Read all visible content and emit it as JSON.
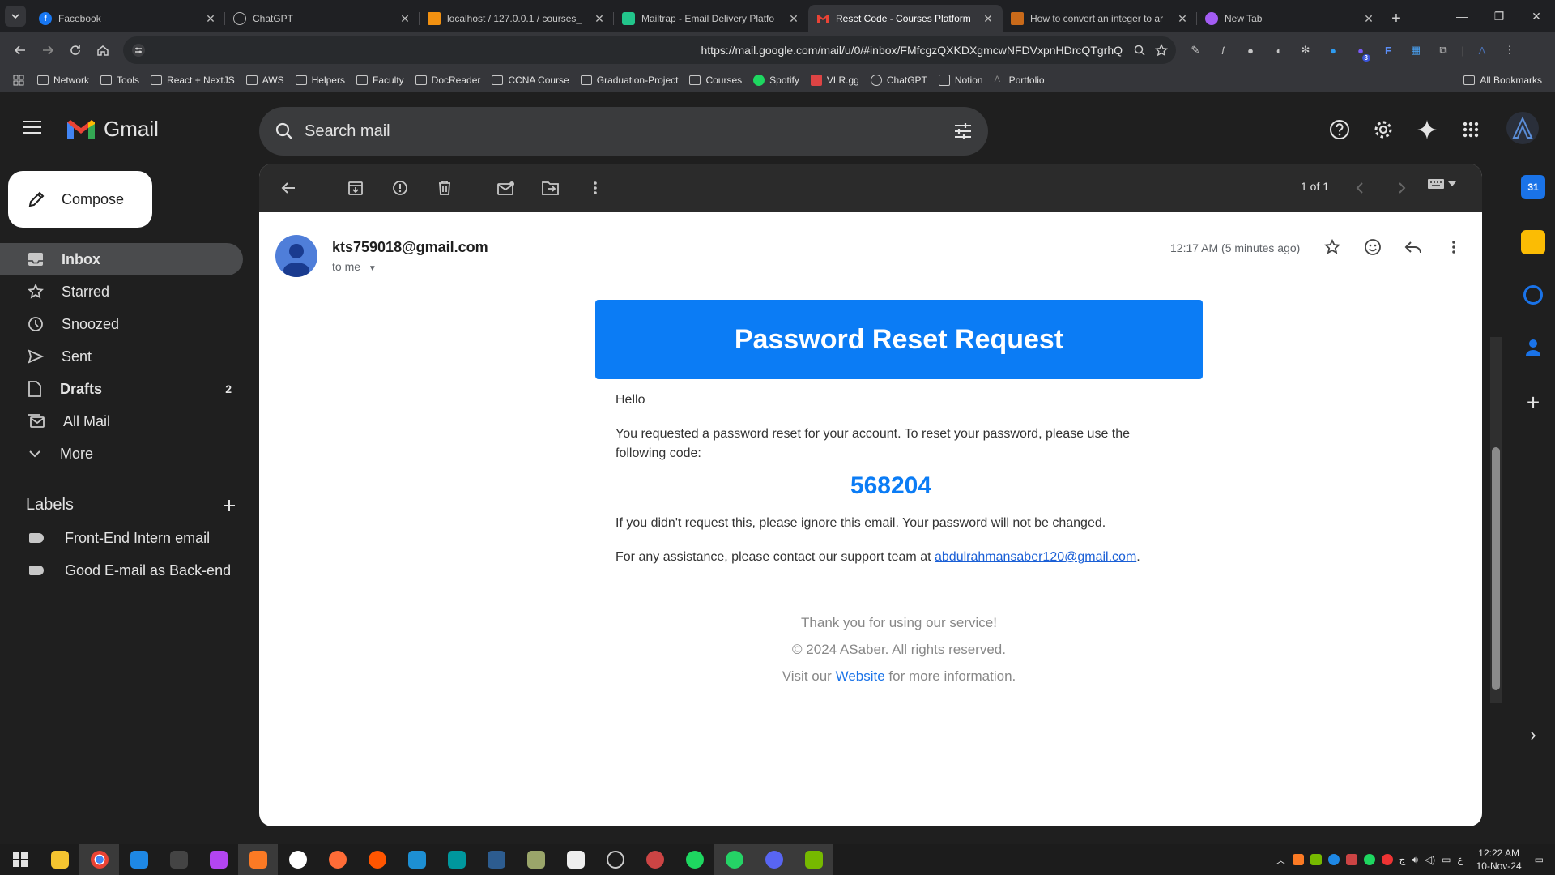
{
  "browser": {
    "tabs": [
      {
        "title": "Facebook",
        "color": "#1877f2",
        "active": false
      },
      {
        "title": "ChatGPT",
        "color": "#9e9e9e",
        "active": false
      },
      {
        "title": "localhost / 127.0.0.1 / courses_",
        "color": "#f29111",
        "active": false
      },
      {
        "title": "Mailtrap - Email Delivery Platfo",
        "color": "#22c58b",
        "active": false
      },
      {
        "title": "Reset Code - Courses Platform",
        "color": "#ea4335",
        "active": true
      },
      {
        "title": "How to convert an integer to ar",
        "color": "#c96a1a",
        "active": false
      },
      {
        "title": "New Tab",
        "color": "#a35cf3",
        "active": false
      }
    ],
    "url": "https://mail.google.com/mail/u/0/#inbox/FMfcgzQXKDXgmcwNFDVxpnHDrcQTgrhQ",
    "bookmarks": [
      "Network",
      "Tools",
      "React + NextJS",
      "AWS",
      "Helpers",
      "Faculty",
      "DocReader",
      "CCNA Course",
      "Graduation-Project",
      "Courses",
      "Spotify",
      "VLR.gg",
      "ChatGPT",
      "Notion",
      "Portfolio"
    ],
    "all_bookmarks": "All Bookmarks",
    "ext_badge": "3"
  },
  "gmail": {
    "logo_text": "Gmail",
    "search_placeholder": "Search mail",
    "compose": "Compose",
    "nav": {
      "inbox": "Inbox",
      "starred": "Starred",
      "snoozed": "Snoozed",
      "sent": "Sent",
      "drafts": "Drafts",
      "drafts_count": "2",
      "all_mail": "All Mail",
      "more": "More"
    },
    "labels_title": "Labels",
    "labels": [
      "Front-End Intern email",
      "Good E-mail as Back-end"
    ],
    "pager": "1 of 1"
  },
  "email": {
    "sender": "kts759018@gmail.com",
    "to": "to me",
    "time": "12:17 AM (5 minutes ago)",
    "header": "Password Reset Request",
    "greeting": "Hello",
    "intro": "You requested a password reset for your account. To reset your password, please use the following code:",
    "code": "568204",
    "ignore": "If you didn't request this, please ignore this email. Your password will not be changed.",
    "assist_prefix": "For any assistance, please contact our support team at",
    "support_email": "abdulrahmansaber120@gmail.com",
    "assist_suffix": ".",
    "thanks": "Thank you for using our service!",
    "copyright": "© 2024 ASaber. All rights reserved.",
    "visit_prefix": "Visit our",
    "website": "Website",
    "visit_suffix": "for more information."
  },
  "taskbar": {
    "time": "12:22 AM",
    "date": "10-Nov-24"
  }
}
